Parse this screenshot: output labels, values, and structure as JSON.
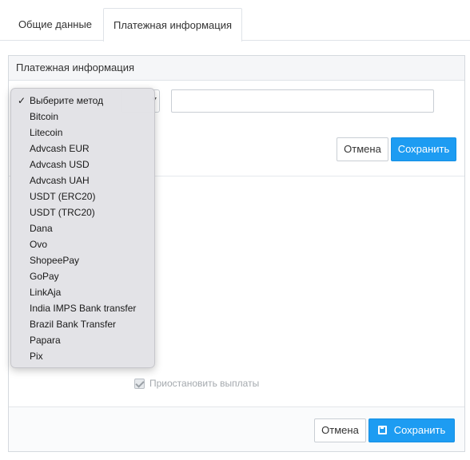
{
  "tabs": [
    {
      "label": "Общие данные",
      "active": false
    },
    {
      "label": "Платежная информация",
      "active": true
    }
  ],
  "panel": {
    "title": "Платежная информация",
    "cancel_label": "Отмена",
    "save_label": "Сохранить",
    "text_input_value": "",
    "checkbox_label": "Приостановить выплаты",
    "checkbox_checked": true,
    "footer_cancel_label": "Отмена",
    "footer_save_label": "Сохранить"
  },
  "dropdown": {
    "selected_check": "✓",
    "options": [
      "Выберите метод",
      "Bitcoin",
      "Litecoin",
      "Advcash EUR",
      "Advcash USD",
      "Advcash UAH",
      "USDT (ERC20)",
      "USDT (TRC20)",
      "Dana",
      "Ovo",
      "ShopeePay",
      "GoPay",
      "LinkAja",
      "India IMPS Bank transfer",
      "Brazil Bank Transfer",
      "Papara",
      "Pix"
    ]
  },
  "colors": {
    "primary": "#1d9cf2",
    "border": "#d5d9de",
    "header_bg": "#f5f6f8"
  },
  "icons": {
    "save": "floppy-disk-icon",
    "select_arrow": "chevron-down-icon",
    "check": "checkmark-icon"
  }
}
